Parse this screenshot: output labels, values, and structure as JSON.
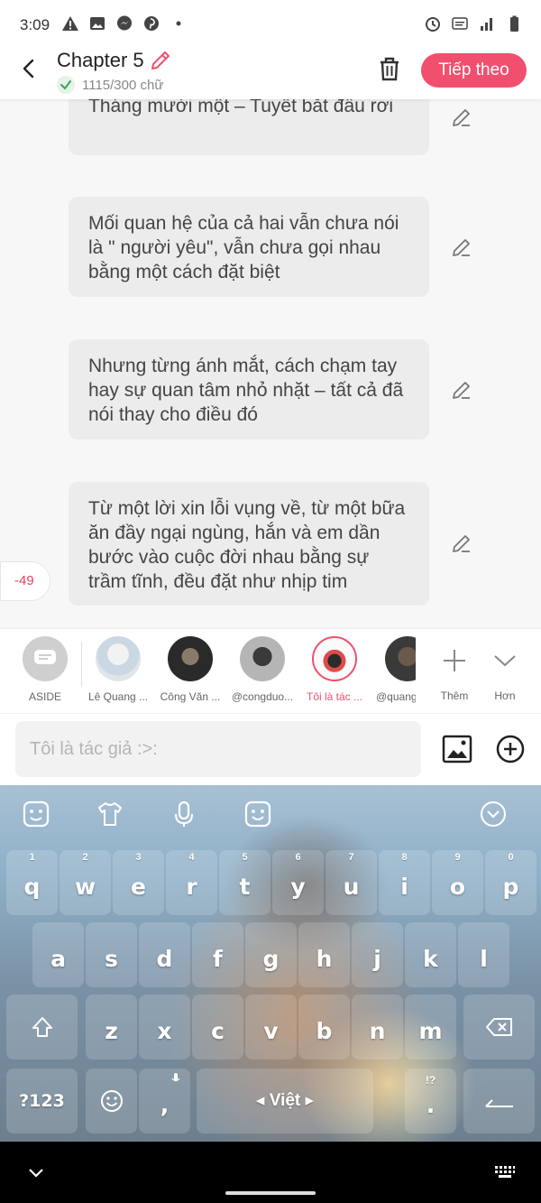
{
  "status_bar": {
    "time": "3:09"
  },
  "header": {
    "title": "Chapter 5",
    "word_count": "1115/300 chữ",
    "next_button": "Tiếp theo"
  },
  "paragraphs": [
    {
      "text": "Tháng mười một – Tuyết bắt đầu rơi"
    },
    {
      "text": "Mối quan hệ của cả hai vẫn chưa nói là \" người yêu\", vẫn chưa gọi nhau bằng một cách đặt biệt"
    },
    {
      "text": "Nhưng từng ánh mắt, cách chạm tay hay sự quan tâm nhỏ nhặt – tất cả đã nói thay cho điều đó"
    },
    {
      "text": "Từ một lời xin lỗi vụng về, từ một bữa ăn đầy ngại ngùng, hắn và em dần bước vào cuộc đời nhau bằng sự trầm tĩnh, đều đặt như nhịp tim"
    }
  ],
  "side_counter": "-49",
  "characters": [
    {
      "name": "ASIDE"
    },
    {
      "name": "Lê Quang ..."
    },
    {
      "name": "Công Văn ..."
    },
    {
      "name": "@congduo..."
    },
    {
      "name": "Tôi là tác ...",
      "color": "#f0506e"
    },
    {
      "name": "@quang..."
    }
  ],
  "tools": {
    "add_label": "Thêm",
    "more_label": "Hơn"
  },
  "composer": {
    "placeholder": "Tôi là tác giả :>:"
  },
  "keyboard": {
    "row1": [
      {
        "key": "q",
        "hint": "1"
      },
      {
        "key": "w",
        "hint": "2"
      },
      {
        "key": "e",
        "hint": "3"
      },
      {
        "key": "r",
        "hint": "4"
      },
      {
        "key": "t",
        "hint": "5"
      },
      {
        "key": "y",
        "hint": "6"
      },
      {
        "key": "u",
        "hint": "7"
      },
      {
        "key": "i",
        "hint": "8"
      },
      {
        "key": "o",
        "hint": "9"
      },
      {
        "key": "p",
        "hint": "0"
      }
    ],
    "row2": [
      "a",
      "s",
      "d",
      "f",
      "g",
      "h",
      "j",
      "k",
      "l"
    ],
    "row3": [
      "z",
      "x",
      "c",
      "v",
      "b",
      "n",
      "m"
    ],
    "symbols_key": "?123",
    "comma_key": ",",
    "space_label": "Việt",
    "period_key": ".",
    "punct_hint": "!?"
  },
  "colors": {
    "accent": "#f0506e",
    "bubble": "#ececec",
    "background": "#f7f7f7"
  }
}
